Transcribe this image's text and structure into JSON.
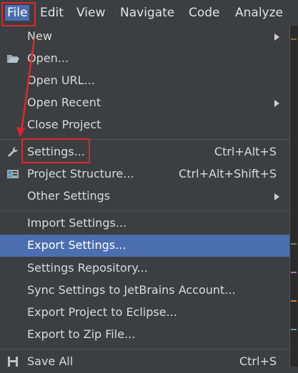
{
  "menubar": {
    "items": [
      "File",
      "Edit",
      "View",
      "Navigate",
      "Code",
      "Analyze"
    ]
  },
  "file_menu": {
    "items": [
      {
        "label": "New",
        "submenu": true
      },
      {
        "label": "Open...",
        "icon": "folder-open-icon"
      },
      {
        "label": "Open URL..."
      },
      {
        "label": "Open Recent",
        "submenu": true
      },
      {
        "label": "Close Project"
      },
      {
        "label": "Settings...",
        "shortcut": "Ctrl+Alt+S",
        "icon": "wrench-icon"
      },
      {
        "label": "Project Structure...",
        "shortcut": "Ctrl+Alt+Shift+S",
        "icon": "project-structure-icon"
      },
      {
        "label": "Other Settings",
        "submenu": true
      },
      {
        "label": "Import Settings..."
      },
      {
        "label": "Export Settings...",
        "selected": true
      },
      {
        "label": "Settings Repository..."
      },
      {
        "label": "Sync Settings to JetBrains Account..."
      },
      {
        "label": "Export Project to Eclipse..."
      },
      {
        "label": "Export to Zip File..."
      },
      {
        "label": "Save All",
        "shortcut": "Ctrl+S",
        "icon": "save-icon"
      }
    ]
  },
  "colors": {
    "background": "#3c3f41",
    "selection": "#4b6eaf",
    "annotation": "#e0262b"
  }
}
